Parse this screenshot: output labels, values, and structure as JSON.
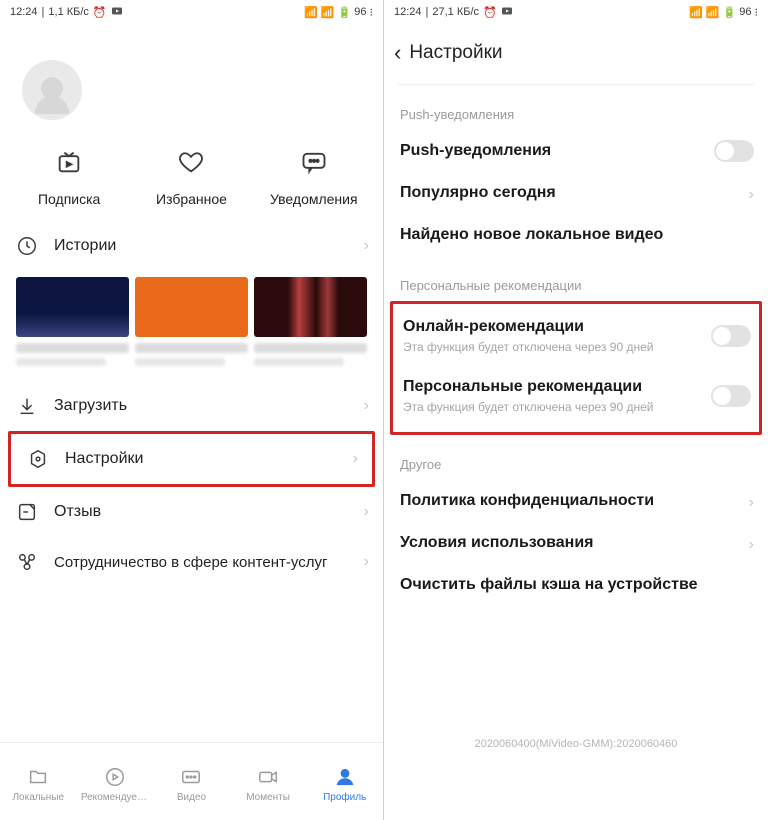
{
  "status": {
    "time": "12:24",
    "speed_left": "1,1 КБ/с",
    "speed_right": "27,1 КБ/с",
    "battery": "96"
  },
  "left": {
    "tri": {
      "subscribe": "Подписка",
      "favorites": "Избранное",
      "notifications": "Уведомления"
    },
    "rows": {
      "history": "Истории",
      "download": "Загрузить",
      "settings": "Настройки",
      "feedback": "Отзыв",
      "coop": "Сотрудничество в сфере контент-услуг"
    },
    "tabs": {
      "local": "Локальные",
      "recommend": "Рекомендуем...",
      "video": "Видео",
      "moments": "Моменты",
      "profile": "Профиль"
    }
  },
  "right": {
    "title": "Настройки",
    "sect_push": "Push-уведомления",
    "push": "Push-уведомления",
    "popular": "Популярно сегодня",
    "found": "Найдено новое локальное видео",
    "sect_pers": "Персональные рекомендации",
    "online_rec": "Онлайн-рекомендации",
    "pers_rec": "Персональные рекомендации",
    "sub90": "Эта функция будет отключена через 90 дней",
    "sect_other": "Другое",
    "privacy": "Политика конфиденциальности",
    "terms": "Условия использования",
    "clear": "Очистить файлы кэша на устройстве",
    "build": "2020060400(MiVideo-GMM):2020060460"
  }
}
